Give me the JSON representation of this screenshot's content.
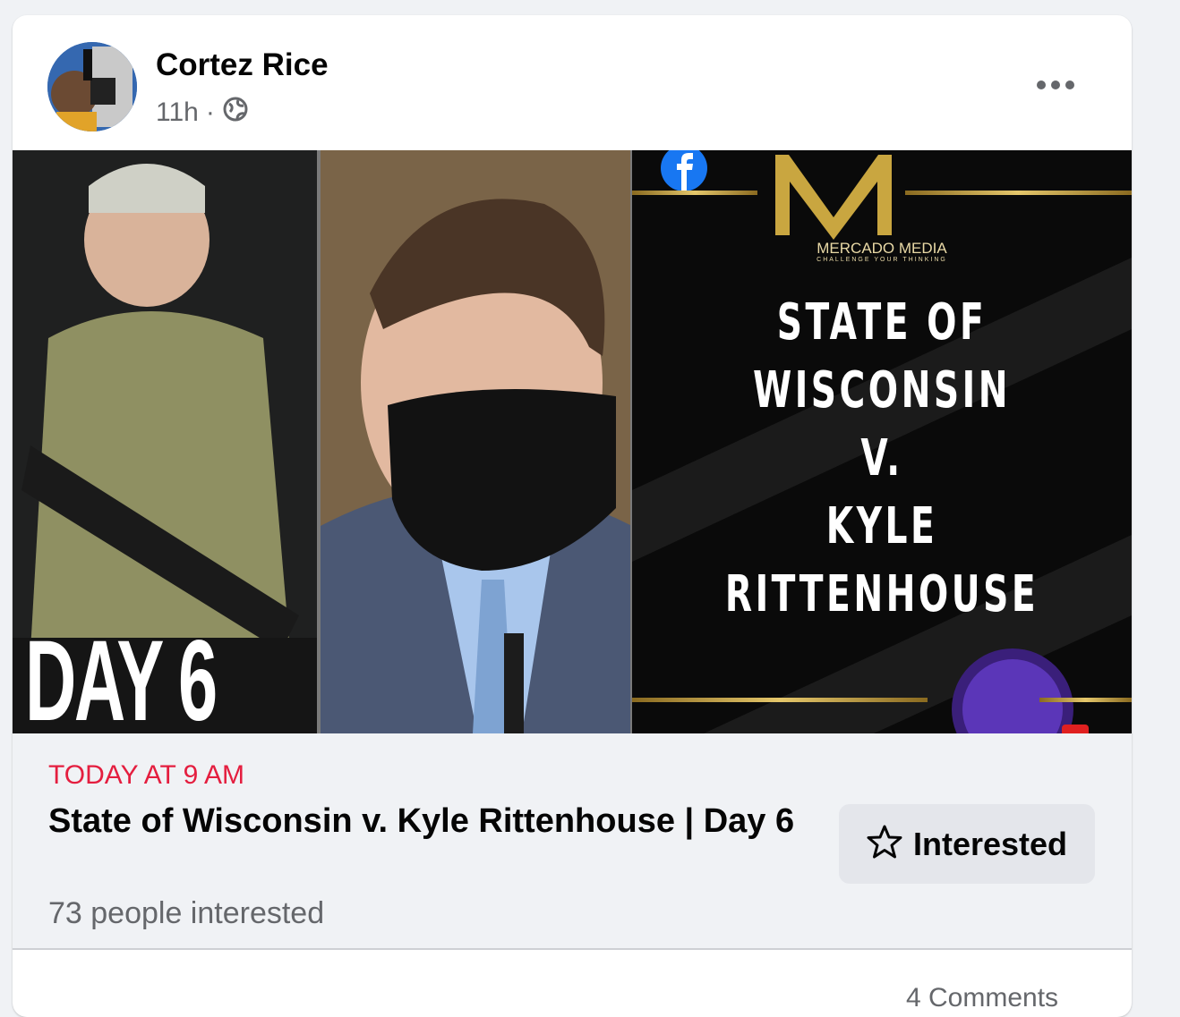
{
  "post": {
    "author": "Cortez Rice",
    "time": "11h",
    "separator": "·",
    "audience_icon": "globe-icon"
  },
  "banner": {
    "left_caption": "DAY 6",
    "brand_name": "MERCADO MEDIA",
    "brand_tagline": "CHALLENGE YOUR THINKING",
    "title_lines": [
      "STATE OF",
      "WISCONSIN",
      "V.",
      "KYLE",
      "RITTENHOUSE"
    ]
  },
  "event": {
    "date": "TODAY AT 9 AM",
    "title": "State of Wisconsin v. Kyle Rittenhouse | Day 6",
    "interested_count": "73 people interested",
    "interested_button": "Interested"
  },
  "comments_label": "4 Comments",
  "colors": {
    "date_red": "#e41e3f",
    "button_bg": "#e4e6eb",
    "page_bg": "#f0f2f5"
  }
}
